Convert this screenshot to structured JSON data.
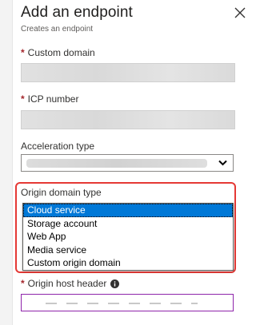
{
  "panel": {
    "title": "Add an endpoint",
    "subtitle": "Creates an endpoint",
    "close_icon": "close-icon"
  },
  "fields": {
    "custom_domain": {
      "label": "Custom domain",
      "required": "*"
    },
    "icp_number": {
      "label": "ICP number",
      "required": "*"
    },
    "acceleration_type": {
      "label": "Acceleration type"
    },
    "origin_domain_type": {
      "label": "Origin domain type",
      "selected": "Cloud service",
      "options": [
        "Cloud service",
        "Storage account",
        "Web App",
        "Media service",
        "Custom origin domain"
      ]
    },
    "origin_host_header": {
      "label": "Origin host header",
      "required": "*",
      "icon": "info-icon"
    }
  },
  "colors": {
    "required": "#a4262c",
    "selected_bg": "#0078d7",
    "highlight_border": "#e53935",
    "host_border": "#8e24aa"
  }
}
